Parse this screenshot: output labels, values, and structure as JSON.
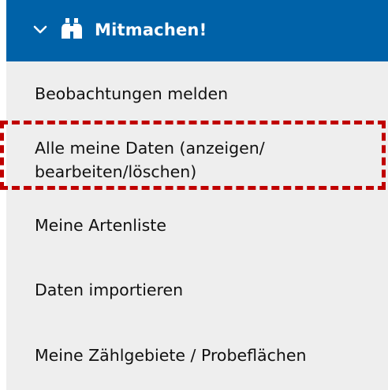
{
  "header": {
    "title": "Mitmachen!",
    "background_color": "#0062a8",
    "chevron_icon": "chevron-down-icon",
    "section_icon": "binoculars-icon"
  },
  "menu": {
    "background_color": "#eeeeee",
    "items": [
      {
        "label": "Beobachtungen melden"
      },
      {
        "label_line1": "Alle meine Daten (anzeigen/",
        "label_line2": "bearbeiten/löschen)",
        "highlighted": true
      },
      {
        "label": "Meine Artenliste"
      },
      {
        "label": "Daten importieren"
      },
      {
        "label": "Meine Zählgebiete / Probeflächen"
      }
    ]
  },
  "highlight_color": "#c00000"
}
